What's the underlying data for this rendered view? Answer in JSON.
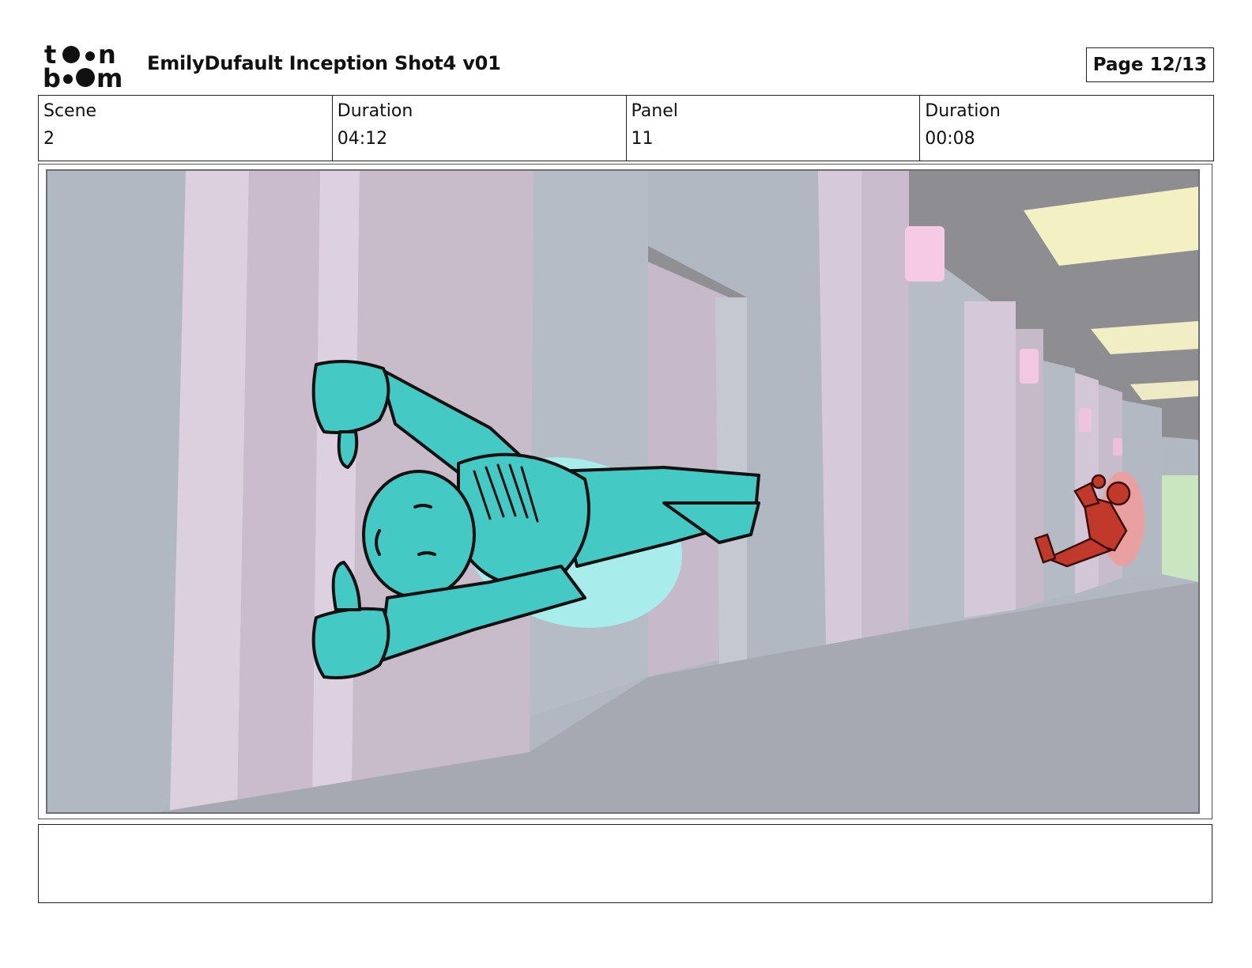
{
  "header": {
    "logo_text": "toon boom",
    "title": "EmilyDufault Inception Shot4 v01",
    "page": "Page 12/13"
  },
  "info": {
    "scene_label": "Scene",
    "scene_value": "2",
    "scene_duration_label": "Duration",
    "scene_duration_value": "04:12",
    "panel_label": "Panel",
    "panel_value": "11",
    "panel_duration_label": "Duration",
    "panel_duration_value": "00:08"
  },
  "panel_image": {
    "characters": [
      "teal-figure-foreground",
      "red-figure-background"
    ],
    "colors": {
      "teal_figure": "#44c9c4",
      "red_figure": "#c0392b",
      "wall_pink": "#d8c8dc",
      "wall_gray": "#b2b8c2",
      "floor": "#a5a8b0",
      "ceiling": "#8e8e90"
    }
  },
  "notes": {
    "text": ""
  }
}
